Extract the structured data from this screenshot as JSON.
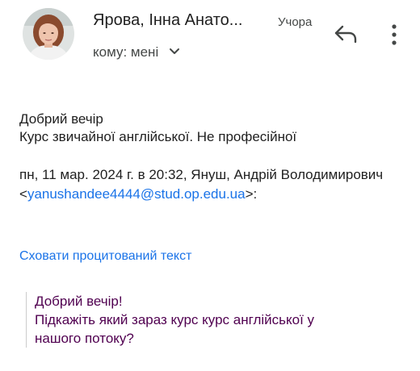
{
  "header": {
    "sender_name": "Ярова, Інна Анато...",
    "date": "Учора",
    "recipient_label": "кому: мені",
    "reply_icon": "reply-icon",
    "more_icon": "more-vert-icon",
    "chevron_icon": "chevron-down-icon"
  },
  "body": {
    "greeting": "Добрий вечір",
    "message": "Курс звичайної англійської. Не професійної"
  },
  "quote_header": {
    "text_before": "пн, 11 мар. 2024 г. в 20:32, Януш, Андрій Володимирович <",
    "email": "yanushandee4444@stud.op.edu.ua",
    "text_after": ">:"
  },
  "hide_quoted_label": "Сховати процитований текст",
  "quoted": {
    "line1": "Добрий вечір!",
    "line2": "Підкажіть який зараз курс курс англійської у",
    "line3": "нашого потоку?"
  },
  "colors": {
    "link": "#1a73e8",
    "quoted_text": "#500050",
    "secondary_text": "#444746"
  }
}
